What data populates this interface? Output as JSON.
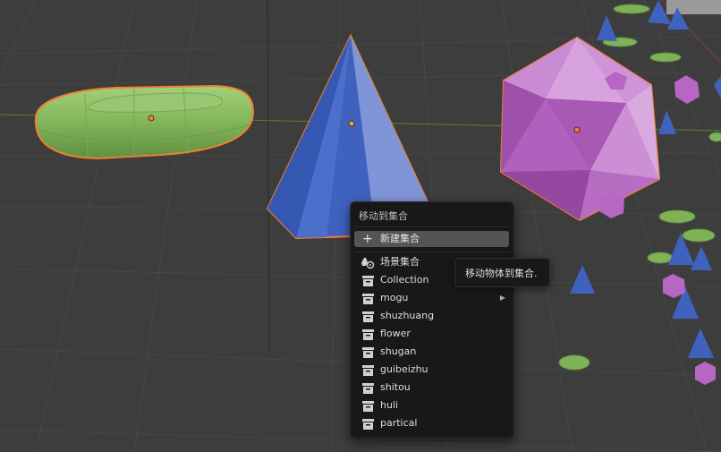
{
  "menu": {
    "title": "移动到集合",
    "new_collection": "新建集合",
    "items": [
      {
        "label": "场景集合",
        "icon": "scene-collection-icon"
      },
      {
        "label": "Collection",
        "icon": "collection-icon"
      },
      {
        "label": "mogu",
        "icon": "collection-icon",
        "has_submenu": true
      },
      {
        "label": "shuzhuang",
        "icon": "collection-icon"
      },
      {
        "label": "flower",
        "icon": "collection-icon"
      },
      {
        "label": "shugan",
        "icon": "collection-icon"
      },
      {
        "label": "guibeizhu",
        "icon": "collection-icon"
      },
      {
        "label": "shitou",
        "icon": "collection-icon"
      },
      {
        "label": "huli",
        "icon": "collection-icon"
      },
      {
        "label": "partical",
        "icon": "collection-icon"
      }
    ]
  },
  "tooltip": {
    "text": "移动物体到集合."
  },
  "colors": {
    "viewport_bg": "#3d3d3d",
    "selection_outline": "#f07f2c",
    "torus_green": "#86b85c",
    "cone_blue": "#3f62bf",
    "ico_purple": "#b766c3",
    "menu_bg": "#181818",
    "menu_highlight": "#545454"
  }
}
